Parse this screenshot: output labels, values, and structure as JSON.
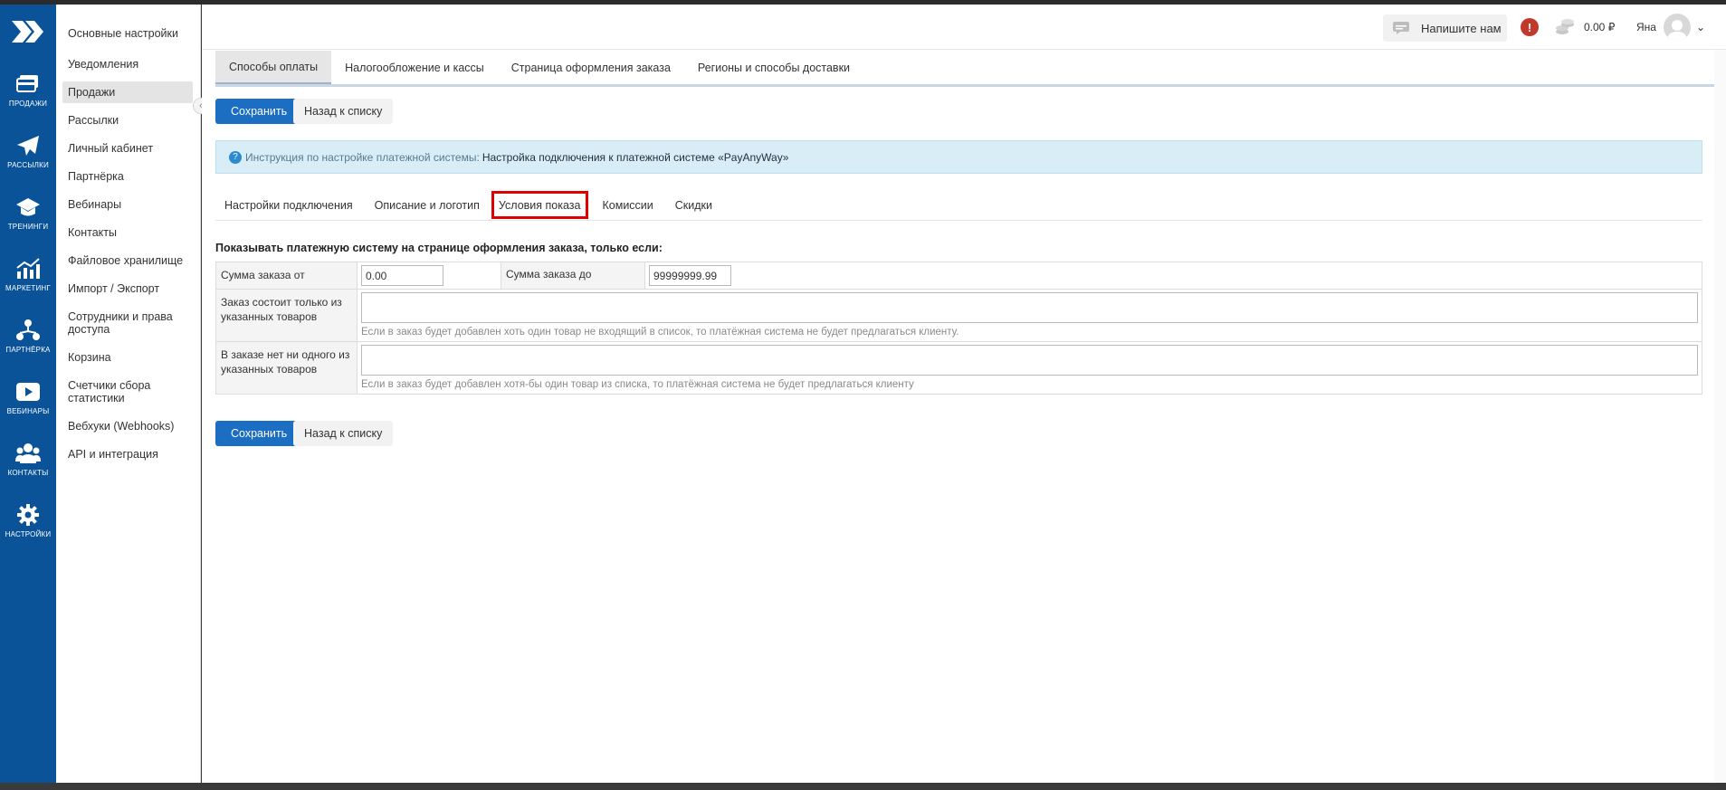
{
  "rail": {
    "items": [
      {
        "label": "ПРОДАЖИ",
        "icon": "card-icon"
      },
      {
        "label": "РАССЫЛКИ",
        "icon": "paper-plane-icon"
      },
      {
        "label": "ТРЕНИНГИ",
        "icon": "graduation-cap-icon"
      },
      {
        "label": "МАРКЕТИНГ",
        "icon": "chart-icon"
      },
      {
        "label": "ПАРТНЁРКА",
        "icon": "network-icon"
      },
      {
        "label": "ВЕБИНАРЫ",
        "icon": "play-icon"
      },
      {
        "label": "КОНТАКТЫ",
        "icon": "users-icon"
      },
      {
        "label": "НАСТРОЙКИ",
        "icon": "gear-icon"
      }
    ]
  },
  "submenu": {
    "items": [
      "Основные настройки",
      "Уведомления",
      "Продажи",
      "Рассылки",
      "Личный кабинет",
      "Партнёрка",
      "Вебинары",
      "Контакты",
      "Файловое хранилище",
      "Импорт / Экспорт",
      "Сотрудники и права доступа",
      "Корзина",
      "Счетчики сбора статистики",
      "Вебхуки (Webhooks)",
      "API и интеграция"
    ],
    "active_index": 2
  },
  "topbar": {
    "write_label": "Напишите нам",
    "alert": "!",
    "balance": "0.00 ₽",
    "user_name": "Яна"
  },
  "tabs": [
    "Способы оплаты",
    "Налогообложение и кассы",
    "Страница оформления заказа",
    "Регионы и способы доставки"
  ],
  "buttons": {
    "save": "Сохранить",
    "back": "Назад к списку"
  },
  "info": {
    "mark": "?",
    "prefix": "Инструкция по настройке платежной системы:",
    "link": "Настройка подключения к платежной системе «PayAnyWay»"
  },
  "subtabs": [
    "Настройки подключения",
    "Описание и логотип",
    "Условия показа",
    "Комиссии",
    "Скидки"
  ],
  "heading": "Показывать платежную систему на странице оформления заказа, только если:",
  "form": {
    "sum_from_label": "Сумма заказа от",
    "sum_from_value": "0.00",
    "sum_to_label": "Сумма заказа до",
    "sum_to_value": "99999999.99",
    "only_label": "Заказ состоит только из указанных товаров",
    "only_hint": "Если в заказ будет добавлен хоть один товар не входящий в список, то платёжная система не будет предлагаться клиенту.",
    "none_label": "В заказе нет ни одного из указанных товаров",
    "none_hint": "Если в заказ будет добавлен хотя-бы один товар из списка, то платёжная система не будет предлагаться клиенту"
  }
}
